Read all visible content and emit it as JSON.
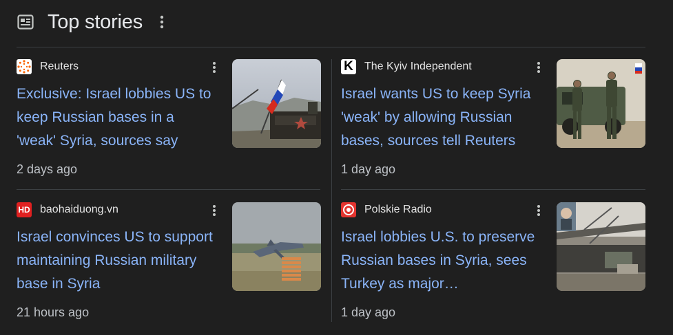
{
  "section": {
    "title": "Top stories",
    "icon": "news-icon"
  },
  "cards": [
    {
      "source": "Reuters",
      "favicon": "reuters-icon",
      "headline": "Exclusive: Israel lobbies US to keep Russian bases in a 'weak' Syria, sources say",
      "time": "2 days ago",
      "thumbnail": "russian-flag-vehicle-image"
    },
    {
      "source": "The Kyiv Independent",
      "favicon": "kyiv-independent-icon",
      "headline": "Israel wants US to keep Syria 'weak' by allowing Russian bases, sources tell Reuters",
      "time": "1 day ago",
      "thumbnail": "soldiers-armored-vehicle-image"
    },
    {
      "source": "baohaiduong.vn",
      "favicon": "baohaiduong-icon",
      "headline": "Israel convinces US to support maintaining Russian military base in Syria",
      "time": "21 hours ago",
      "thumbnail": "fighter-jet-runway-image"
    },
    {
      "source": "Polskie Radio",
      "favicon": "polskie-radio-icon",
      "headline": "Israel lobbies U.S. to preserve Russian bases in Syria, sees Turkey as major…",
      "time": "1 day ago",
      "thumbnail": "military-base-structure-image"
    }
  ],
  "favicon_text": {
    "baohaiduong": "HD",
    "kyiv": "K"
  },
  "colors": {
    "headline": "#8ab4f8",
    "background": "#1f1f1f",
    "divider": "#3c4043",
    "secondary_text": "#bdc1c6"
  }
}
